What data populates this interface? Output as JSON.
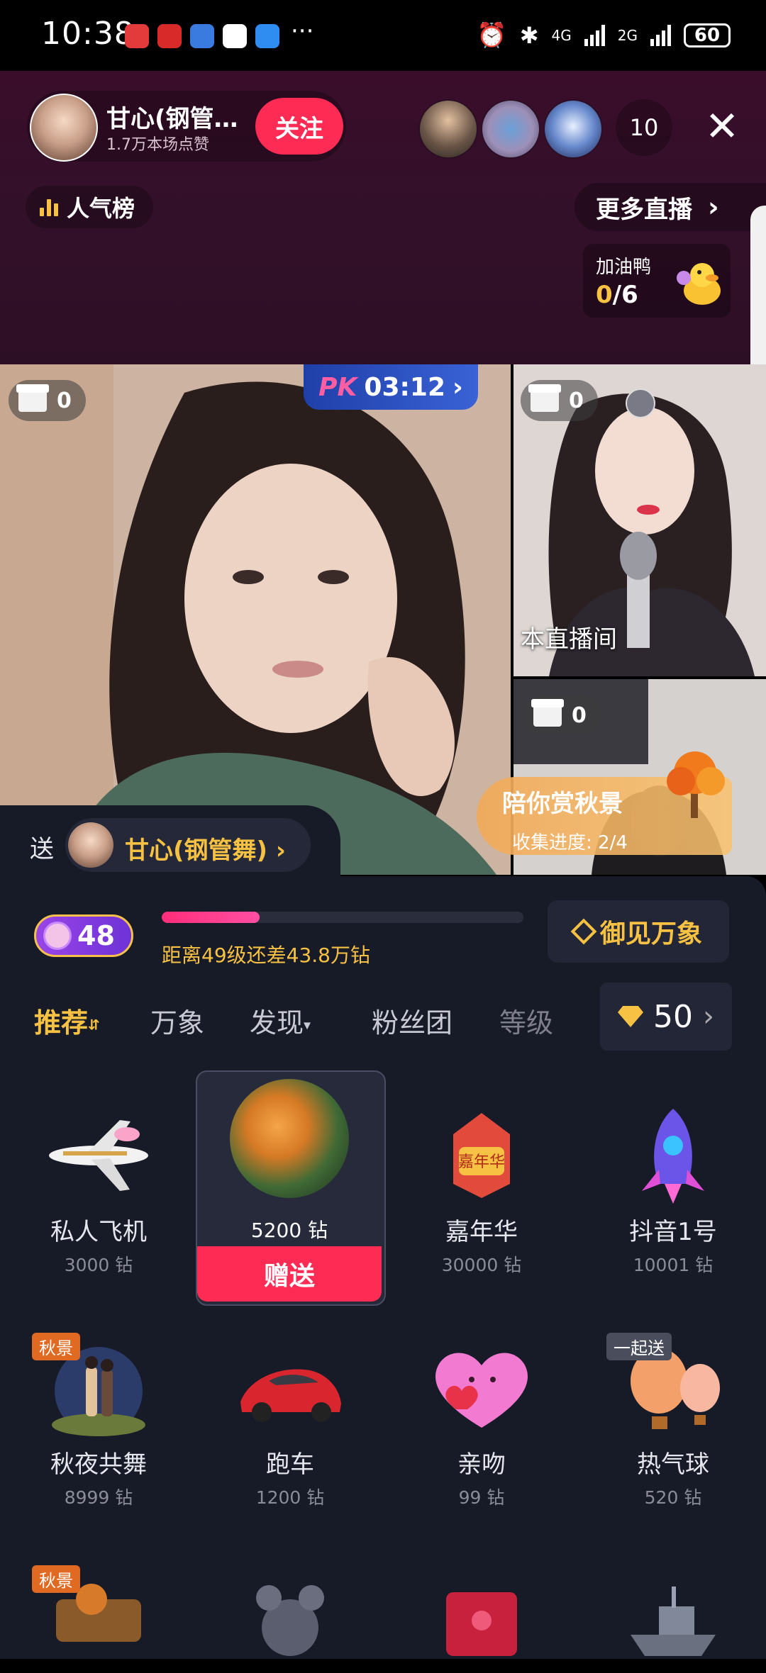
{
  "status_bar": {
    "time": "10:38",
    "network_1": "4G",
    "network_2": "2G",
    "battery": "60"
  },
  "header": {
    "host_name": "甘心(钢管…",
    "host_likes": "1.7万本场点赞",
    "follow_label": "关注",
    "viewer_count": "10",
    "close_icon": "close-icon",
    "rank_label": "人气榜",
    "more_live_label": "更多直播",
    "duck_label": "加油鸭",
    "duck_current": "0",
    "duck_total": "/6"
  },
  "video": {
    "pk_prefix": "PK",
    "pk_time": "03:12",
    "main_gift_count": "0",
    "r1_gift_count": "0",
    "r2_gift_count": "0",
    "room_label": "本直播间",
    "autumn_title": "陪你赏秋景",
    "autumn_progress": "收集进度: 2/4"
  },
  "panel": {
    "send_label": "送",
    "send_target": "甘心(钢管舞)",
    "level": "48",
    "level_progress": 0.27,
    "level_text": "距离49级还差43.8万钻",
    "yujian_label": "御见万象",
    "tabs": [
      "推荐",
      "万象",
      "发现",
      "粉丝团",
      "等级"
    ],
    "balance": "50",
    "colors": {
      "accent_gold": "#f7c243",
      "accent_red": "#fe2c55",
      "panel_bg": "#171a27"
    }
  },
  "gifts": [
    {
      "name": "私人飞机",
      "price": "3000 钻"
    },
    {
      "name": "",
      "price": "5200 钻",
      "action": "赠送"
    },
    {
      "name": "嘉年华",
      "price": "30000 钻"
    },
    {
      "name": "抖音1号",
      "price": "10001 钻"
    },
    {
      "name": "秋夜共舞",
      "price": "8999 钻",
      "tag": "秋景"
    },
    {
      "name": "跑车",
      "price": "1200 钻"
    },
    {
      "name": "亲吻",
      "price": "99 钻"
    },
    {
      "name": "热气球",
      "price": "520 钻",
      "tag": "一起送"
    },
    {
      "tag": "秋景"
    }
  ]
}
